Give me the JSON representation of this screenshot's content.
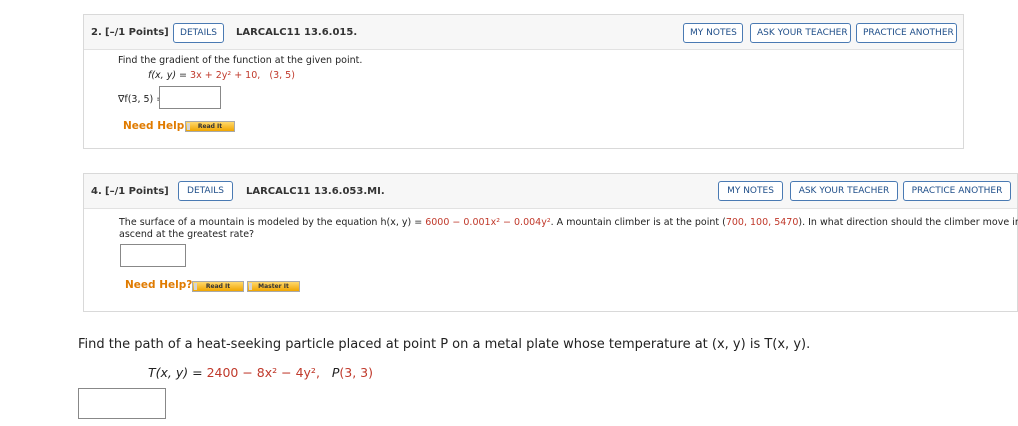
{
  "q2": {
    "number": "2.",
    "points": "[–/1 Points]",
    "details_label": "DETAILS",
    "code": "LARCALC11 13.6.015.",
    "my_notes_label": "MY NOTES",
    "ask_teacher_label": "ASK YOUR TEACHER",
    "practice_label": "PRACTICE ANOTHER",
    "prompt": "Find the gradient of the function at the given point.",
    "function_lhs": "f(x, y) = ",
    "function_rhs": "3x + 2y² + 10,",
    "point": "(3, 5)",
    "gradient_label": "∇f(3, 5) =",
    "answer_value": "",
    "need_help": "Need Help?",
    "read_it": "Read It"
  },
  "q4": {
    "number": "4.",
    "points": "[–/1 Points]",
    "details_label": "DETAILS",
    "code": "LARCALC11 13.6.053.MI.",
    "my_notes_label": "MY NOTES",
    "ask_teacher_label": "ASK YOUR TEACHER",
    "practice_label": "PRACTICE ANOTHER",
    "prompt_part1": "The surface of a mountain is modeled by the equation h(x, y) = ",
    "equation": "6000 − 0.001x² − 0.004y²",
    "prompt_part2": ". A mountain climber is at the point (",
    "point": "700, 100, 5470",
    "prompt_part3": "). In what direction should the climber move in order to",
    "prompt_line2": "ascend at the greatest rate?",
    "answer_value": "",
    "need_help": "Need Help?",
    "read_it": "Read It",
    "master_it": "Master It"
  },
  "q5": {
    "prompt": "Find the path of a heat-seeking particle placed at point P on a metal plate whose temperature at (x, y) is T(x, y).",
    "eq_lhs": "T(x, y) = ",
    "eq_rhs": "2400 − 8x² − 4y²,",
    "point_label": "P",
    "point_value": "(3, 3)",
    "answer_value": ""
  },
  "colors": {
    "accent_blue": "#1f4e89",
    "need_help_orange": "#e07b00",
    "value_red": "#c0392b"
  }
}
